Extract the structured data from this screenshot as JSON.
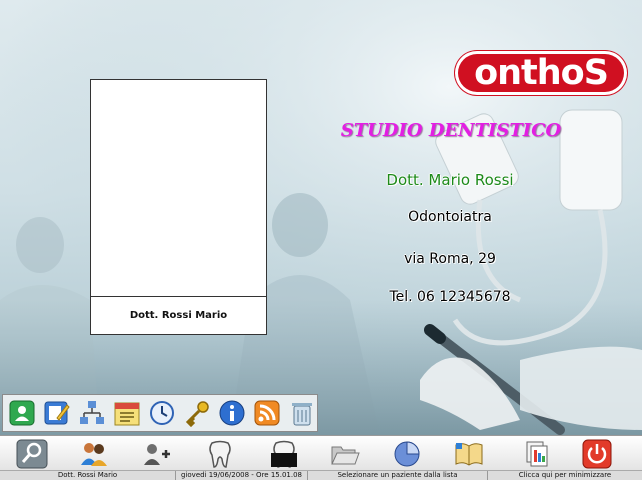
{
  "brand": {
    "logo_text": "onthoS",
    "logo_color": "#d01021"
  },
  "studio": {
    "title": "STUDIO DENTISTICO",
    "doctor": "Dott. Mario Rossi",
    "specialty": "Odontoiatra",
    "address": "via Roma, 29",
    "phone": "Tel. 06 12345678"
  },
  "photo_card": {
    "caption": "Dott. Rossi Mario"
  },
  "quick_toolbar": [
    {
      "icon": "user-card-icon"
    },
    {
      "icon": "edit-document-icon"
    },
    {
      "icon": "network-icon"
    },
    {
      "icon": "calendar-icon"
    },
    {
      "icon": "clock-icon"
    },
    {
      "icon": "key-icon"
    },
    {
      "icon": "info-icon"
    },
    {
      "icon": "rss-icon"
    },
    {
      "icon": "recycle-bin-icon"
    }
  ],
  "main_toolbar": [
    {
      "icon": "search-icon"
    },
    {
      "icon": "patients-icon"
    },
    {
      "icon": "add-patient-icon"
    },
    {
      "icon": "tooth-icon"
    },
    {
      "icon": "tooth-treatment-icon"
    },
    {
      "icon": "folder-open-icon"
    },
    {
      "icon": "pie-chart-icon"
    },
    {
      "icon": "book-icon"
    },
    {
      "icon": "documents-icon"
    },
    {
      "icon": "power-icon"
    }
  ],
  "status_bar": {
    "user": "Dott. Rossi Mario",
    "datetime": "giovedi 19/06/2008 - Ore 15.01.08",
    "hint": "Selezionare un paziente dalla lista",
    "minimize": "Clicca qui per minimizzare"
  }
}
